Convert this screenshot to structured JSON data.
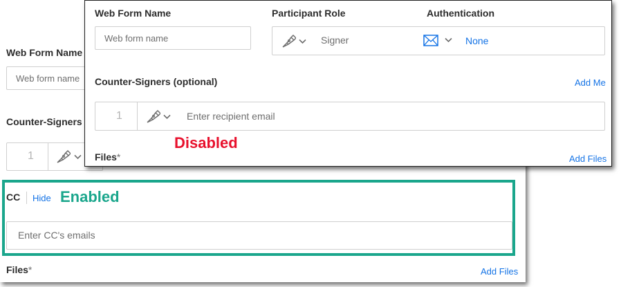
{
  "back_panel": {
    "web_form_name_label": "Web Form Name",
    "web_form_name_placeholder": "Web form name",
    "counter_signers_label": "Counter-Signers (",
    "recipient_number": "1",
    "cc_label": "CC",
    "cc_hide_link": "Hide",
    "cc_placeholder": "Enter CC's emails",
    "files_label": "Files",
    "files_required_mark": "*",
    "add_files_link": "Add Files"
  },
  "front_panel": {
    "web_form_name_label": "Web Form Name",
    "web_form_name_placeholder": "Web form name",
    "participant_role_label": "Participant Role",
    "participant_role_value": "Signer",
    "authentication_label": "Authentication",
    "authentication_value": "None",
    "counter_signers_label": "Counter-Signers (optional)",
    "add_me_link": "Add Me",
    "recipient_number": "1",
    "recipient_placeholder": "Enter recipient email",
    "files_label": "Files",
    "files_required_mark": "*",
    "add_files_link": "Add Files"
  },
  "annotations": {
    "disabled": "Disabled",
    "enabled": "Enabled"
  },
  "colors": {
    "disabled": "#e8102c",
    "enabled": "#1aa68c",
    "link": "#1473e6",
    "icon": "#6e6e6e",
    "mail_icon": "#1473e6"
  },
  "icons": {
    "signer": "fountain-pen-icon",
    "dropdown": "chevron-down-icon",
    "authentication": "mail-icon"
  }
}
